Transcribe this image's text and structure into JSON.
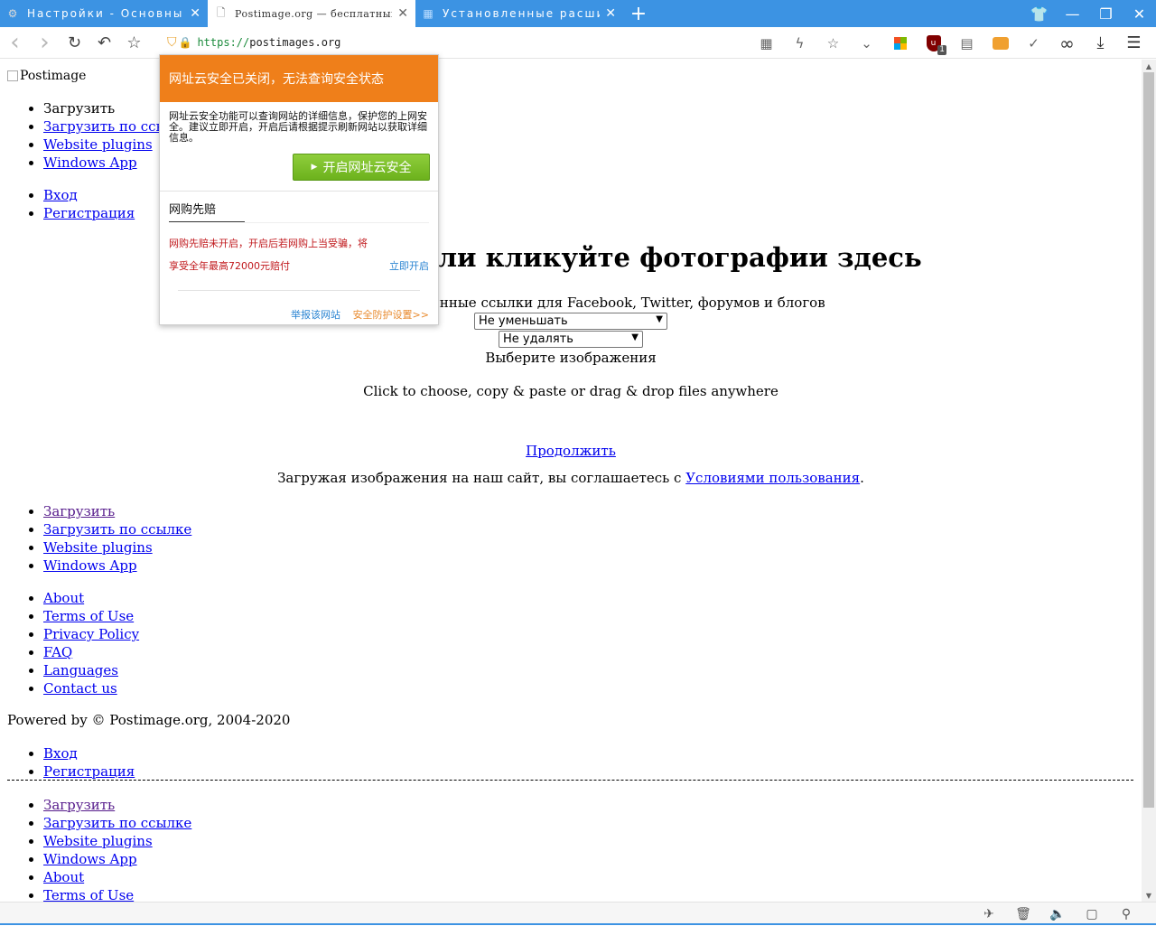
{
  "browser": {
    "tabs": [
      {
        "title": "Настройки - Основные",
        "icon": "gear-icon",
        "active": false
      },
      {
        "title": "Postimage.org — бесплатный хостинг",
        "icon": "page-icon",
        "active": true
      },
      {
        "title": "Установленные расширения",
        "icon": "extensions-icon",
        "active": false
      }
    ],
    "new_tab": "+",
    "window_controls": {
      "skin": "👕",
      "minimize": "—",
      "restore": "❐",
      "close": "✕"
    },
    "toolbar": {
      "back": "‹",
      "forward": "›",
      "reload": "↻",
      "undo": "↶",
      "bookmark": "☆"
    },
    "url": {
      "scheme": "https://",
      "host": "postimages.org"
    },
    "right_icons": {
      "qr": "▦",
      "lightning": "ϟ",
      "star": "☆",
      "dropdown": "⌄",
      "ublock_label": "u",
      "ublock_badge": "1",
      "reader": "▤",
      "check": "✓",
      "binoculars": "∞",
      "download": "⤓",
      "menu": "☰"
    }
  },
  "page": {
    "logo_alt": "Postimage",
    "top_nav": [
      {
        "label": "Загрузить",
        "link": false
      },
      {
        "label": "Загрузить по ссылке",
        "link": true
      },
      {
        "label": "Website plugins",
        "link": true
      },
      {
        "label": "Windows App",
        "link": true
      }
    ],
    "account_nav": [
      {
        "label": "Вход"
      },
      {
        "label": "Регистрация"
      }
    ],
    "headline": "Перетащите или кликуйте фотографии здесь",
    "subtitle": "Получите постоянные ссылки для Facebook, Twitter, форумов и блогов",
    "resize_select": "Не уменьшать",
    "expire_select": "Не удалять",
    "choose_images": "Выберите изображения",
    "drag_hint": "Click to choose, copy & paste or drag & drop files anywhere",
    "continue": "Продолжить",
    "terms_prefix": "Загружая изображения на наш сайт, вы соглашаетесь с ",
    "terms_link": "Условиями пользования",
    "terms_suffix": ".",
    "footer_nav1": [
      {
        "label": "Загрузить",
        "visited": true
      },
      {
        "label": "Загрузить по ссылке"
      },
      {
        "label": "Website plugins"
      },
      {
        "label": "Windows App"
      }
    ],
    "footer_nav2": [
      {
        "label": "About"
      },
      {
        "label": "Terms of Use"
      },
      {
        "label": "Privacy Policy"
      },
      {
        "label": "FAQ"
      },
      {
        "label": "Languages"
      },
      {
        "label": "Contact us"
      }
    ],
    "powered_by": "Powered by © Postimage.org, 2004-2020",
    "footer_account": [
      {
        "label": "Вход"
      },
      {
        "label": "Регистрация"
      }
    ],
    "bottom_nav": [
      {
        "label": "Загрузить",
        "visited": true
      },
      {
        "label": "Загрузить по ссылке"
      },
      {
        "label": "Website plugins"
      },
      {
        "label": "Windows App"
      },
      {
        "label": "About"
      },
      {
        "label": "Terms of Use"
      }
    ]
  },
  "popup": {
    "header": "网址云安全已关闭，无法查询安全状态",
    "body": "网址云安全功能可以查询网站的详细信息，保护您的上网安全。建议立即开启，开启后请根据提示刷新网站以获取详细信息。",
    "button": "开启网址云安全",
    "section_title": "网购先赔",
    "warning_line1": "网购先赔未开启，开启后若网购上当受骗，将",
    "warning_line2": "享受全年最高72000元赔付",
    "enable_now": "立即开启",
    "report_site": "举报该网站",
    "protection_settings": "安全防护设置>>"
  },
  "statusbar": {
    "icons": [
      "✈",
      "🗑",
      "🔈",
      "▢",
      "⚲"
    ]
  },
  "colors": {
    "tab_bar": "#3c93e3",
    "popup_header": "#ef7f1a",
    "popup_button": "#7cc12a",
    "link": "#0000ee"
  }
}
